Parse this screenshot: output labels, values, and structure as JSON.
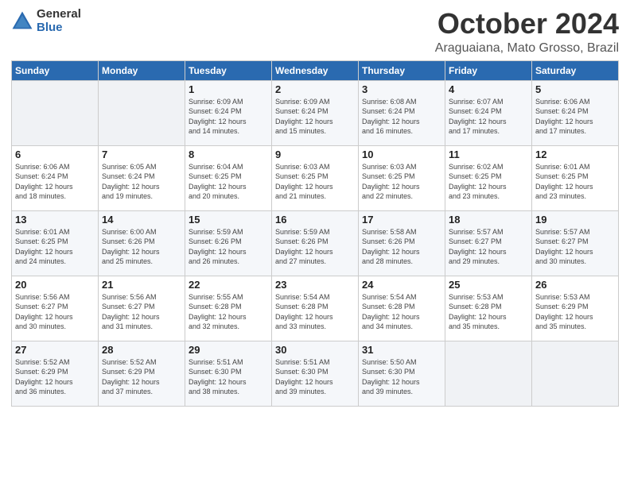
{
  "logo": {
    "general": "General",
    "blue": "Blue"
  },
  "title": {
    "month": "October 2024",
    "location": "Araguaiana, Mato Grosso, Brazil"
  },
  "weekdays": [
    "Sunday",
    "Monday",
    "Tuesday",
    "Wednesday",
    "Thursday",
    "Friday",
    "Saturday"
  ],
  "weeks": [
    [
      {
        "day": "",
        "info": ""
      },
      {
        "day": "",
        "info": ""
      },
      {
        "day": "1",
        "info": "Sunrise: 6:09 AM\nSunset: 6:24 PM\nDaylight: 12 hours\nand 14 minutes."
      },
      {
        "day": "2",
        "info": "Sunrise: 6:09 AM\nSunset: 6:24 PM\nDaylight: 12 hours\nand 15 minutes."
      },
      {
        "day": "3",
        "info": "Sunrise: 6:08 AM\nSunset: 6:24 PM\nDaylight: 12 hours\nand 16 minutes."
      },
      {
        "day": "4",
        "info": "Sunrise: 6:07 AM\nSunset: 6:24 PM\nDaylight: 12 hours\nand 17 minutes."
      },
      {
        "day": "5",
        "info": "Sunrise: 6:06 AM\nSunset: 6:24 PM\nDaylight: 12 hours\nand 17 minutes."
      }
    ],
    [
      {
        "day": "6",
        "info": "Sunrise: 6:06 AM\nSunset: 6:24 PM\nDaylight: 12 hours\nand 18 minutes."
      },
      {
        "day": "7",
        "info": "Sunrise: 6:05 AM\nSunset: 6:24 PM\nDaylight: 12 hours\nand 19 minutes."
      },
      {
        "day": "8",
        "info": "Sunrise: 6:04 AM\nSunset: 6:25 PM\nDaylight: 12 hours\nand 20 minutes."
      },
      {
        "day": "9",
        "info": "Sunrise: 6:03 AM\nSunset: 6:25 PM\nDaylight: 12 hours\nand 21 minutes."
      },
      {
        "day": "10",
        "info": "Sunrise: 6:03 AM\nSunset: 6:25 PM\nDaylight: 12 hours\nand 22 minutes."
      },
      {
        "day": "11",
        "info": "Sunrise: 6:02 AM\nSunset: 6:25 PM\nDaylight: 12 hours\nand 23 minutes."
      },
      {
        "day": "12",
        "info": "Sunrise: 6:01 AM\nSunset: 6:25 PM\nDaylight: 12 hours\nand 23 minutes."
      }
    ],
    [
      {
        "day": "13",
        "info": "Sunrise: 6:01 AM\nSunset: 6:25 PM\nDaylight: 12 hours\nand 24 minutes."
      },
      {
        "day": "14",
        "info": "Sunrise: 6:00 AM\nSunset: 6:26 PM\nDaylight: 12 hours\nand 25 minutes."
      },
      {
        "day": "15",
        "info": "Sunrise: 5:59 AM\nSunset: 6:26 PM\nDaylight: 12 hours\nand 26 minutes."
      },
      {
        "day": "16",
        "info": "Sunrise: 5:59 AM\nSunset: 6:26 PM\nDaylight: 12 hours\nand 27 minutes."
      },
      {
        "day": "17",
        "info": "Sunrise: 5:58 AM\nSunset: 6:26 PM\nDaylight: 12 hours\nand 28 minutes."
      },
      {
        "day": "18",
        "info": "Sunrise: 5:57 AM\nSunset: 6:27 PM\nDaylight: 12 hours\nand 29 minutes."
      },
      {
        "day": "19",
        "info": "Sunrise: 5:57 AM\nSunset: 6:27 PM\nDaylight: 12 hours\nand 30 minutes."
      }
    ],
    [
      {
        "day": "20",
        "info": "Sunrise: 5:56 AM\nSunset: 6:27 PM\nDaylight: 12 hours\nand 30 minutes."
      },
      {
        "day": "21",
        "info": "Sunrise: 5:56 AM\nSunset: 6:27 PM\nDaylight: 12 hours\nand 31 minutes."
      },
      {
        "day": "22",
        "info": "Sunrise: 5:55 AM\nSunset: 6:28 PM\nDaylight: 12 hours\nand 32 minutes."
      },
      {
        "day": "23",
        "info": "Sunrise: 5:54 AM\nSunset: 6:28 PM\nDaylight: 12 hours\nand 33 minutes."
      },
      {
        "day": "24",
        "info": "Sunrise: 5:54 AM\nSunset: 6:28 PM\nDaylight: 12 hours\nand 34 minutes."
      },
      {
        "day": "25",
        "info": "Sunrise: 5:53 AM\nSunset: 6:28 PM\nDaylight: 12 hours\nand 35 minutes."
      },
      {
        "day": "26",
        "info": "Sunrise: 5:53 AM\nSunset: 6:29 PM\nDaylight: 12 hours\nand 35 minutes."
      }
    ],
    [
      {
        "day": "27",
        "info": "Sunrise: 5:52 AM\nSunset: 6:29 PM\nDaylight: 12 hours\nand 36 minutes."
      },
      {
        "day": "28",
        "info": "Sunrise: 5:52 AM\nSunset: 6:29 PM\nDaylight: 12 hours\nand 37 minutes."
      },
      {
        "day": "29",
        "info": "Sunrise: 5:51 AM\nSunset: 6:30 PM\nDaylight: 12 hours\nand 38 minutes."
      },
      {
        "day": "30",
        "info": "Sunrise: 5:51 AM\nSunset: 6:30 PM\nDaylight: 12 hours\nand 39 minutes."
      },
      {
        "day": "31",
        "info": "Sunrise: 5:50 AM\nSunset: 6:30 PM\nDaylight: 12 hours\nand 39 minutes."
      },
      {
        "day": "",
        "info": ""
      },
      {
        "day": "",
        "info": ""
      }
    ]
  ]
}
